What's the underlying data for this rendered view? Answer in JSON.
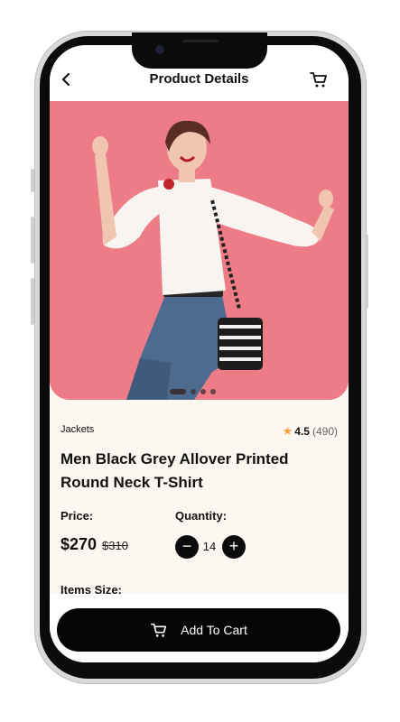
{
  "header": {
    "title": "Product Details"
  },
  "product": {
    "category": "Jackets",
    "rating": "4.5",
    "rating_count": "(490)",
    "title": "Men Black Grey Allover Printed Round Neck T-Shirt",
    "price_label": "Price:",
    "price": "$270",
    "old_price": "$310",
    "quantity_label": "Quantity:",
    "quantity": "14",
    "size_label": "Items Size:"
  },
  "carousel": {
    "dots": 4,
    "active_index": 0
  },
  "actions": {
    "add_to_cart_label": "Add To Cart"
  },
  "icons": {
    "back": "chevron-left-icon",
    "cart": "shopping-cart-icon",
    "star": "star-icon",
    "minus": "minus-icon",
    "plus": "plus-icon"
  },
  "colors": {
    "hero_background": "#ee7c86",
    "screen_background": "#fdf7f1",
    "button": "#050505",
    "star": "#f6a13a"
  }
}
